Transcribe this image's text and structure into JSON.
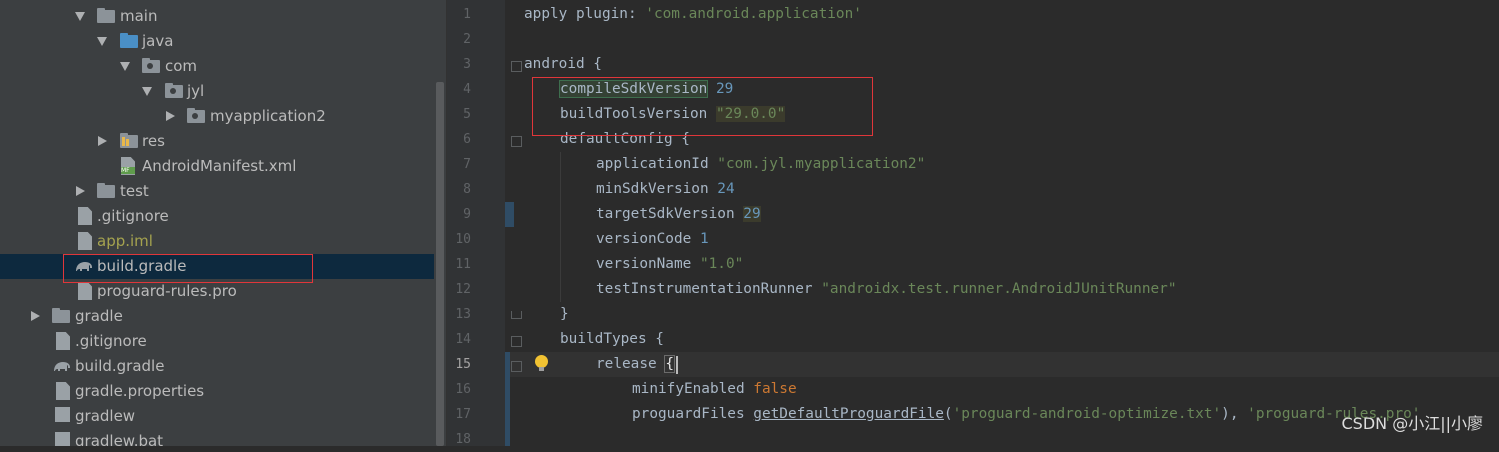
{
  "project_tree": {
    "items": [
      {
        "label": "main",
        "kind": "folder",
        "expanded": true
      },
      {
        "label": "java",
        "kind": "folder-blue",
        "expanded": true
      },
      {
        "label": "com",
        "kind": "package",
        "expanded": true
      },
      {
        "label": "jyl",
        "kind": "package",
        "expanded": true
      },
      {
        "label": "myapplication2",
        "kind": "package",
        "expanded": false
      },
      {
        "label": "res",
        "kind": "res-folder",
        "expanded": false
      },
      {
        "label": "AndroidManifest.xml",
        "kind": "manifest-file",
        "icon_tag": "MF"
      },
      {
        "label": "test",
        "kind": "folder",
        "expanded": false
      },
      {
        "label": ".gitignore",
        "kind": "file"
      },
      {
        "label": "app.iml",
        "kind": "iml-file"
      },
      {
        "label": "build.gradle",
        "kind": "gradle-file",
        "selected": true
      },
      {
        "label": "proguard-rules.pro",
        "kind": "file"
      },
      {
        "label": "gradle",
        "kind": "folder",
        "expanded": false
      },
      {
        "label": ".gitignore",
        "kind": "file"
      },
      {
        "label": "build.gradle",
        "kind": "gradle-file"
      },
      {
        "label": "gradle.properties",
        "kind": "properties-file"
      },
      {
        "label": "gradlew",
        "kind": "file"
      },
      {
        "label": "gradlew.bat",
        "kind": "file"
      }
    ]
  },
  "editor": {
    "line_numbers": [
      "1",
      "2",
      "3",
      "4",
      "5",
      "6",
      "7",
      "8",
      "9",
      "10",
      "11",
      "12",
      "13",
      "14",
      "15",
      "16",
      "17",
      "18"
    ],
    "current_line": "15",
    "lines": {
      "l1": {
        "a": "apply plugin: ",
        "b": "'com.android.application'"
      },
      "l3": {
        "a": "android {"
      },
      "l4": {
        "a": "compileSdkVersion",
        "b": "29"
      },
      "l5": {
        "a": "buildToolsVersion ",
        "b": "\"29.0.0\""
      },
      "l6": {
        "a": "defaultConfig {"
      },
      "l7": {
        "a": "applicationId ",
        "b": "\"com.jyl.myapplication2\""
      },
      "l8": {
        "a": "minSdkVersion ",
        "b": "24"
      },
      "l9": {
        "a": "targetSdkVersion ",
        "b": "29"
      },
      "l10": {
        "a": "versionCode ",
        "b": "1"
      },
      "l11": {
        "a": "versionName ",
        "b": "\"1.0\""
      },
      "l12": {
        "a": "testInstrumentationRunner ",
        "b": "\"androidx.test.runner.AndroidJUnitRunner\""
      },
      "l13": {
        "a": "}"
      },
      "l14": {
        "a": "buildTypes {"
      },
      "l15": {
        "a": "release ",
        "b": "{"
      },
      "l16": {
        "a": "minifyEnabled ",
        "b": "false"
      },
      "l17": {
        "a": "proguardFiles ",
        "b": "getDefaultProguardFile",
        "c": "(",
        "d": "'proguard-android-optimize.txt'",
        "e": "), ",
        "f": "'proguard-rules.pro'"
      }
    }
  },
  "watermark": "CSDN @小江||小廖",
  "colors": {
    "accent_red_box": "#e0363a",
    "selection": "#0d293e",
    "keyword": "#cc7832",
    "string": "#6a8759",
    "number": "#6897bb"
  }
}
